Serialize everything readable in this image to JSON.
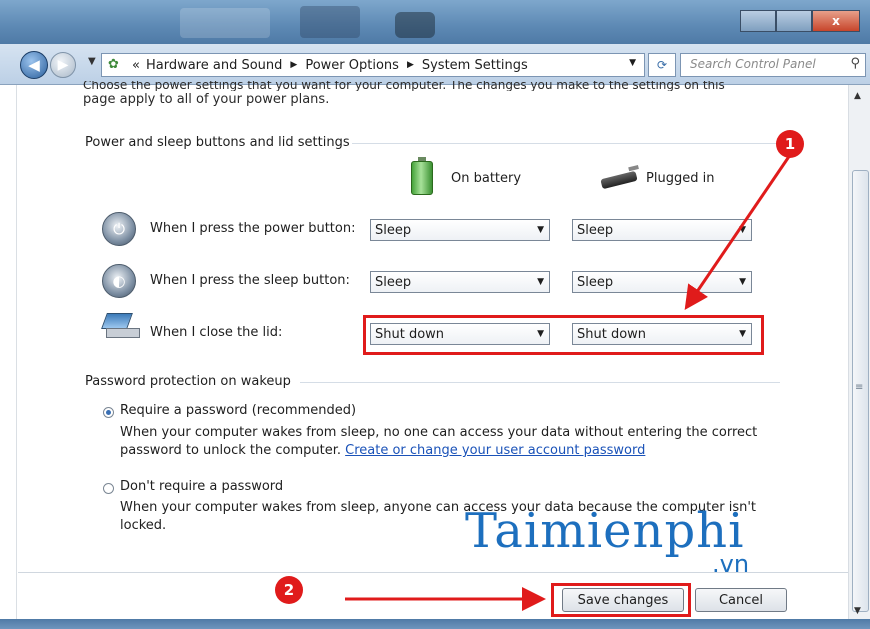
{
  "window": {
    "min_label": "",
    "max_label": "",
    "close_label": "x"
  },
  "nav": {
    "back_glyph": "◀",
    "forward_glyph": "▶",
    "breadcrumb": [
      "Hardware and Sound",
      "Power Options",
      "System Settings"
    ],
    "breadcrumb_prefix": "«",
    "search_placeholder": "Search Control Panel"
  },
  "intro": {
    "line1": "Choose the power settings that you want for your computer. The changes you make to the settings on this",
    "line2": "page apply to all of your power plans."
  },
  "power_section": {
    "title": "Power and sleep buttons and lid settings",
    "col_battery": "On battery",
    "col_plugged": "Plugged in",
    "rows": [
      {
        "label": "When I press the power button:",
        "battery": "Sleep",
        "plugged": "Sleep",
        "icon": "power-button-icon"
      },
      {
        "label": "When I press the sleep button:",
        "battery": "Sleep",
        "plugged": "Sleep",
        "icon": "sleep-button-icon"
      },
      {
        "label": "When I close the lid:",
        "battery": "Shut down",
        "plugged": "Shut down",
        "icon": "laptop-lid-icon"
      }
    ]
  },
  "password_section": {
    "title": "Password protection on wakeup",
    "options": [
      {
        "label": "Require a password (recommended)",
        "selected": true,
        "desc1": "When your computer wakes from sleep, no one can access your data without entering the correct",
        "desc2_text": "password to unlock the computer.",
        "link": "Create or change your user account password"
      },
      {
        "label": "Don't require a password",
        "selected": false,
        "desc1": "When your computer wakes from sleep, anyone can access your data because the computer isn't",
        "desc2_text": "locked."
      }
    ]
  },
  "annotations": {
    "badge1": "1",
    "badge2": "2",
    "color": "#e01b1b"
  },
  "watermark": {
    "main": "Taimienphi",
    "sub": ".vn"
  },
  "buttons": {
    "save": "Save changes",
    "cancel": "Cancel"
  }
}
